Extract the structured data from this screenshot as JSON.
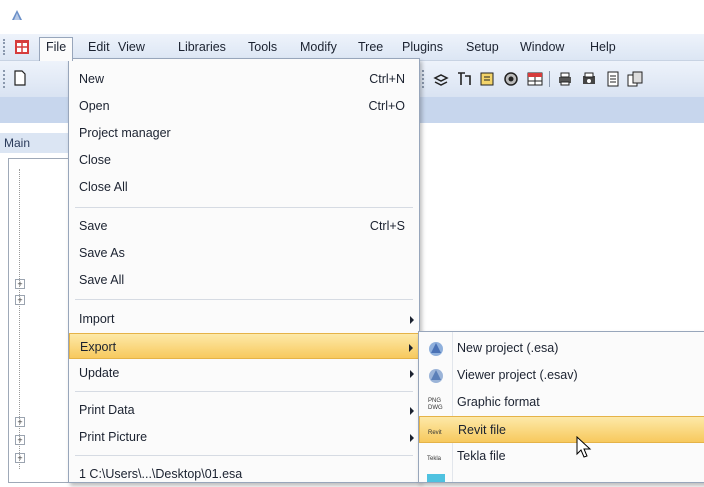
{
  "menubar": {
    "items": [
      "File",
      "Edit",
      "View",
      "Libraries",
      "Tools",
      "Modify",
      "Tree",
      "Plugins",
      "Setup",
      "Window",
      "Help"
    ]
  },
  "panel": {
    "tab_label": "Main"
  },
  "file_menu": {
    "items": [
      {
        "label": "New",
        "shortcut": "Ctrl+N"
      },
      {
        "label": "Open",
        "shortcut": "Ctrl+O"
      },
      {
        "label": "Project manager",
        "shortcut": ""
      },
      {
        "label": "Close",
        "shortcut": ""
      },
      {
        "label": "Close All",
        "shortcut": ""
      },
      {
        "label": "Save",
        "shortcut": "Ctrl+S"
      },
      {
        "label": "Save As",
        "shortcut": ""
      },
      {
        "label": "Save All",
        "shortcut": ""
      },
      {
        "label": "Import",
        "shortcut": ""
      },
      {
        "label": "Export",
        "shortcut": ""
      },
      {
        "label": "Update",
        "shortcut": ""
      },
      {
        "label": "Print Data",
        "shortcut": ""
      },
      {
        "label": "Print Picture",
        "shortcut": ""
      },
      {
        "label": "1 C:\\Users\\...\\Desktop\\01.esa",
        "shortcut": ""
      }
    ]
  },
  "export_submenu": {
    "items": [
      {
        "label": "New project (.esa)",
        "icon": "esa-project-icon",
        "icon_text": ""
      },
      {
        "label": "Viewer project (.esav)",
        "icon": "viewer-project-icon",
        "icon_text": ""
      },
      {
        "label": "Graphic format",
        "icon": "graphic-format-icon",
        "icon_text": "PNG\nDWG"
      },
      {
        "label": "Revit file",
        "icon": "revit-icon",
        "icon_text": "Revit"
      },
      {
        "label": "Tekla file",
        "icon": "tekla-icon",
        "icon_text": "Tekla"
      }
    ]
  },
  "colors": {
    "highlight": "#f7c95e",
    "menubar": "#dce6f4",
    "band": "#c7d6ed"
  }
}
